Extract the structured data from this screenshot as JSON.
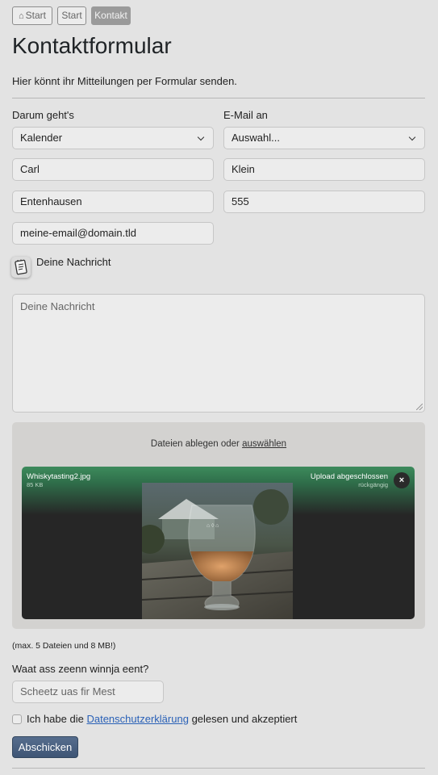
{
  "breadcrumb": {
    "home_icon": "home-icon",
    "items": [
      {
        "label": "Start"
      },
      {
        "label": "Start"
      },
      {
        "label": "Kontakt"
      }
    ]
  },
  "page": {
    "title": "Kontaktformular",
    "intro": "Hier könnt ihr Mitteilungen per Formular senden."
  },
  "form": {
    "topic_label": "Darum geht's",
    "topic_value": "Kalender",
    "email_to_label": "E-Mail an",
    "email_to_value": "Auswahl...",
    "first_name": "Carl",
    "last_name": "Klein",
    "city": "Entenhausen",
    "phone": "555",
    "email": "meine-email@domain.tld",
    "message_label": "Deine Nachricht",
    "message_placeholder": "Deine Nachricht",
    "message_icon": "notepad-icon"
  },
  "upload": {
    "drop_text": "Dateien ablegen oder",
    "drop_link": "auswählen",
    "file": {
      "name": "Whiskytasting2.jpg",
      "size": "85 KB",
      "status": "Upload abgeschlossen",
      "undo": "rückgängig",
      "close": "×"
    },
    "limit_note": "(max. 5 Dateien und 8 MB!)"
  },
  "captcha": {
    "question": "Waat ass zeenn winnja eent?",
    "placeholder": "Scheetz uas fir Mest"
  },
  "consent": {
    "prefix": "Ich habe die",
    "link": "Datenschutzerklärung",
    "suffix": "gelesen und akzeptiert"
  },
  "submit_label": "Abschicken",
  "colors": {
    "background": "#e3e3e3",
    "submit": "#4a6080",
    "link": "#2a61b7",
    "upload_header": "#3d8b5c"
  }
}
